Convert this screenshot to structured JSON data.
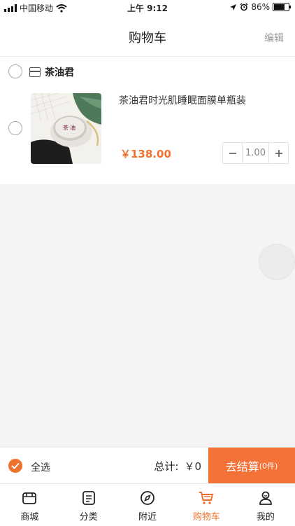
{
  "status_bar": {
    "carrier": "中国移动",
    "time": "上午 9:12",
    "battery": "86%",
    "battery_level": 0.86
  },
  "header": {
    "title": "购物车",
    "edit_label": "编辑"
  },
  "cart": {
    "store_name": "茶油君",
    "items": [
      {
        "name": "茶油君时光肌睡眠面膜单瓶装",
        "price": "￥138.00",
        "quantity": "1.00"
      }
    ]
  },
  "checkout": {
    "select_all_label": "全选",
    "total_label": "总计:",
    "total_value": "￥0",
    "checkout_label": "去结算",
    "checkout_count": "(0件)"
  },
  "tabbar": {
    "tabs": [
      {
        "label": "商城",
        "icon": "store-icon"
      },
      {
        "label": "分类",
        "icon": "list-icon"
      },
      {
        "label": "附近",
        "icon": "compass-icon"
      },
      {
        "label": "购物车",
        "icon": "cart-icon"
      },
      {
        "label": "我的",
        "icon": "user-icon"
      }
    ],
    "active_index": 3
  },
  "colors": {
    "accent": "#f0702e",
    "checkout_button": "#f47138"
  }
}
